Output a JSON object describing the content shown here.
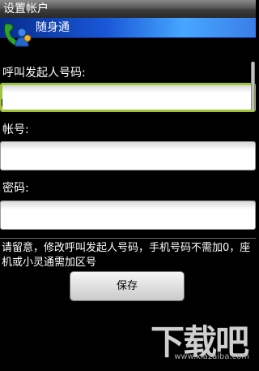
{
  "window": {
    "title": "设置帐户"
  },
  "app": {
    "name": "随身通"
  },
  "form": {
    "caller_label": "呼叫发起人号码:",
    "caller_value": "",
    "account_label": "帐号:",
    "account_value": "",
    "password_label": "密码:",
    "password_value": ""
  },
  "note": "请留意，修改呼叫发起人号码，手机号码不需加0，座机或小灵通需加区号",
  "save_button": {
    "label": "保存"
  },
  "watermark": {
    "text": "下载吧",
    "url": "www.xiazaiba.com"
  },
  "colors": {
    "focus": "#9fc23a",
    "appbar": "#1a58d8"
  }
}
